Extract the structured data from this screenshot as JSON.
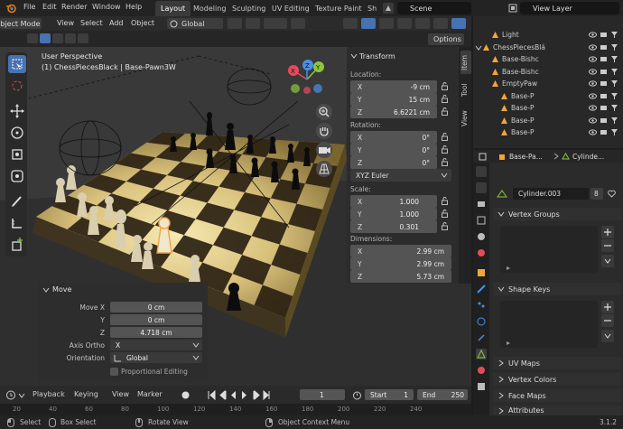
{
  "topbar": {
    "menus": [
      "File",
      "Edit",
      "Render",
      "Window",
      "Help"
    ],
    "workspaces": [
      "Layout",
      "Modeling",
      "Sculpting",
      "UV Editing",
      "Texture Paint",
      "Sh"
    ],
    "active_workspace": "Layout",
    "scene": "Scene",
    "view_layer": "View Layer"
  },
  "viewport_header": {
    "mode": "Object Mode",
    "menus": [
      "View",
      "Select",
      "Add",
      "Object"
    ],
    "orientation": "Global",
    "options_label": "Options"
  },
  "viewport": {
    "perspective_label": "User Perspective",
    "object_label": "(1) ChessPiecesBlack | Base-Pawn3W",
    "gizmo_axes": [
      "X",
      "Y",
      "Z"
    ]
  },
  "npanel": {
    "section_title": "Transform",
    "location_label": "Location:",
    "location": [
      {
        "axis": "X",
        "value": "-9 cm"
      },
      {
        "axis": "Y",
        "value": "15 cm"
      },
      {
        "axis": "Z",
        "value": "6.6221 cm"
      }
    ],
    "rotation_label": "Rotation:",
    "rotation": [
      {
        "axis": "X",
        "value": "0°"
      },
      {
        "axis": "Y",
        "value": "0°"
      },
      {
        "axis": "Z",
        "value": "0°"
      }
    ],
    "rotation_mode": "XYZ Euler",
    "scale_label": "Scale:",
    "scale": [
      {
        "axis": "X",
        "value": "1.000"
      },
      {
        "axis": "Y",
        "value": "1.000"
      },
      {
        "axis": "Z",
        "value": "0.301"
      }
    ],
    "dimensions_label": "Dimensions:",
    "dimensions": [
      {
        "axis": "X",
        "value": "2.99 cm"
      },
      {
        "axis": "Y",
        "value": "2.99 cm"
      },
      {
        "axis": "Z",
        "value": "5.73 cm"
      }
    ],
    "tabs": [
      "Item",
      "Tool",
      "View"
    ]
  },
  "move_panel": {
    "title": "Move",
    "move_x_label": "Move X",
    "move_x": "0 cm",
    "y_label": "Y",
    "move_y": "0 cm",
    "z_label": "Z",
    "move_z": "4.718 cm",
    "axis_ortho_label": "Axis Ortho",
    "axis_ortho": "X",
    "orientation_label": "Orientation",
    "orientation": "Global",
    "proportional_label": "Proportional Editing"
  },
  "outliner": {
    "rows": [
      {
        "label": "Light",
        "indent": 1
      },
      {
        "label": "ChessPiecesBlá",
        "indent": 0
      },
      {
        "label": "Base-Bishc",
        "indent": 1
      },
      {
        "label": "Base-Bishc",
        "indent": 1
      },
      {
        "label": "EmptyPaw",
        "indent": 1
      },
      {
        "label": "Base-P",
        "indent": 2
      },
      {
        "label": "Base-P",
        "indent": 2
      },
      {
        "label": "Base-P",
        "indent": 2
      },
      {
        "label": "Base-P",
        "indent": 2
      }
    ]
  },
  "properties": {
    "breadcrumb_object": "Base-Pa...",
    "breadcrumb_data": "Cylinde...",
    "mesh_name": "Cylinder.003",
    "users": "8",
    "sections": [
      "Vertex Groups",
      "Shape Keys",
      "UV Maps",
      "Vertex Colors",
      "Face Maps",
      "Attributes"
    ]
  },
  "timeline": {
    "menus": [
      "Playback",
      "Keying",
      "View",
      "Marker"
    ],
    "current_frame": "1",
    "start_label": "Start",
    "start": "1",
    "end_label": "End",
    "end": "250",
    "ruler_ticks": [
      "20",
      "40",
      "60",
      "80",
      "100",
      "120",
      "140",
      "160",
      "180",
      "200",
      "220",
      "240"
    ]
  },
  "statusbar": {
    "select": "Select",
    "box_select": "Box Select",
    "rotate_view": "Rotate View",
    "context_menu": "Object Context Menu",
    "version": "3.1.2"
  },
  "colors": {
    "accent": "#4772b3",
    "x_axis": "#e44b5b",
    "y_axis": "#8cc63f",
    "z_axis": "#4a90e2",
    "active_object": "#f3a43b"
  }
}
